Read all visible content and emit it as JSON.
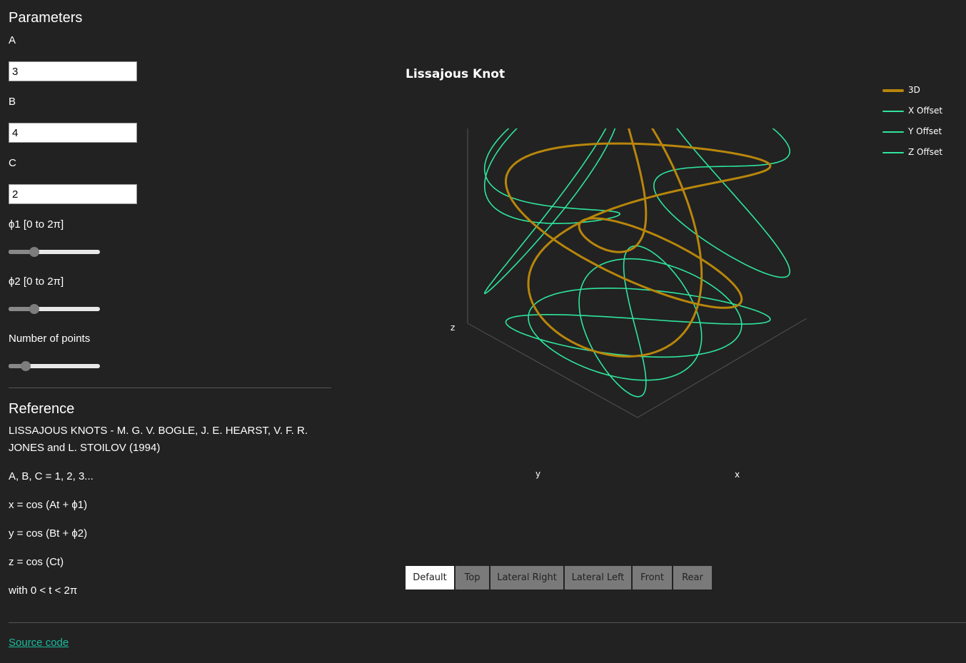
{
  "sidebar": {
    "title": "Parameters",
    "fields": [
      {
        "label": "A",
        "value": "3"
      },
      {
        "label": "B",
        "value": "4"
      },
      {
        "label": "C",
        "value": "2"
      }
    ],
    "sliders": [
      {
        "label": "ϕ1 [0 to 2π]",
        "level": 0.28
      },
      {
        "label": "ϕ2 [0 to 2π]",
        "level": 0.28
      },
      {
        "label": "Number of points",
        "level": 0.19
      }
    ]
  },
  "reference": {
    "title": "Reference",
    "citation": "LISSAJOUS KNOTS - M. G. V. BOGLE, J. E. HEARST, V. F. R. JONES and L. STOILOV (1994)",
    "line1": "A, B, C = 1, 2, 3...",
    "line2": "x = cos (At + ϕ1)",
    "line3": "y = cos (Bt + ϕ2)",
    "line4": "z = cos (Ct)",
    "line5": "with 0 < t < 2π"
  },
  "footer": {
    "source_link": "Source code"
  },
  "plot": {
    "title": "Lissajous Knot",
    "axes": {
      "x": "x",
      "y": "y",
      "z": "z"
    },
    "legend": [
      {
        "name": "3D",
        "color": "#b8860b"
      },
      {
        "name": "X Offset",
        "color": "#2ee59d"
      },
      {
        "name": "Y Offset",
        "color": "#2ee59d"
      },
      {
        "name": "Z Offset",
        "color": "#2ee59d"
      }
    ],
    "view_buttons": [
      {
        "label": "Default",
        "active": true
      },
      {
        "label": "Top",
        "active": false
      },
      {
        "label": "Lateral Right",
        "active": false
      },
      {
        "label": "Lateral Left",
        "active": false
      },
      {
        "label": "Front",
        "active": false
      },
      {
        "label": "Rear",
        "active": false
      }
    ]
  },
  "params": {
    "A": 3,
    "B": 4,
    "C": 2,
    "phi1": 1.76,
    "phi2": 1.76,
    "points": 300
  }
}
